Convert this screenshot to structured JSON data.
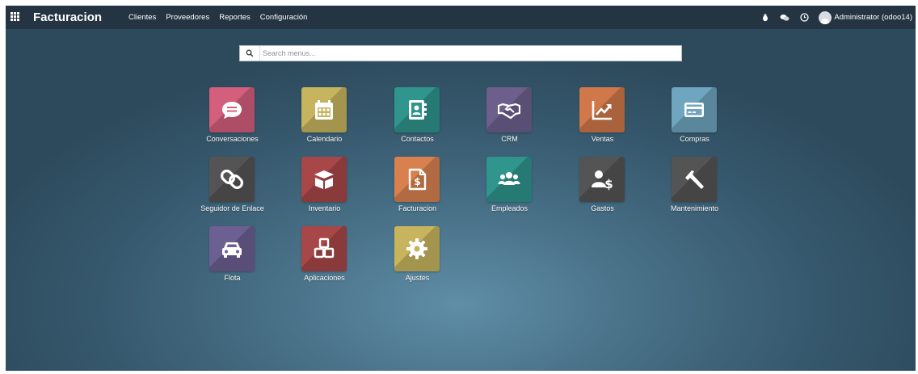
{
  "topbar": {
    "brand": "Facturacion",
    "menu": [
      "Clientes",
      "Proveedores",
      "Reportes",
      "Configuración"
    ],
    "user": "Administrator (odoo14)",
    "icons": [
      "apps-grid-icon",
      "bug-icon",
      "chat-icon",
      "clock-icon"
    ]
  },
  "search": {
    "placeholder": "Search menus..."
  },
  "apps": [
    {
      "label": "Conversaciones",
      "color": "#d35f7c",
      "icon": "chat-bubble-icon"
    },
    {
      "label": "Calendario",
      "color": "#c7b45f",
      "icon": "calendar-icon"
    },
    {
      "label": "Contactos",
      "color": "#2f958d",
      "icon": "address-book-icon"
    },
    {
      "label": "CRM",
      "color": "#6d5f8c",
      "icon": "handshake-icon"
    },
    {
      "label": "Ventas",
      "color": "#d0784a",
      "icon": "chart-line-icon"
    },
    {
      "label": "Compras",
      "color": "#6fa5be",
      "icon": "credit-card-icon"
    },
    {
      "label": "Seguidor de Enlace",
      "color": "#545454",
      "icon": "link-icon"
    },
    {
      "label": "Inventario",
      "color": "#a84747",
      "icon": "box-icon"
    },
    {
      "label": "Facturacion",
      "color": "#d8814f",
      "icon": "invoice-icon"
    },
    {
      "label": "Empleados",
      "color": "#2f958d",
      "icon": "users-icon"
    },
    {
      "label": "Gastos",
      "color": "#545454",
      "icon": "user-dollar-icon"
    },
    {
      "label": "Mantenimiento",
      "color": "#545454",
      "icon": "hammer-icon"
    },
    {
      "label": "Flota",
      "color": "#6c5f92",
      "icon": "car-icon"
    },
    {
      "label": "Aplicaciones",
      "color": "#a84747",
      "icon": "cubes-icon"
    },
    {
      "label": "Ajustes",
      "color": "#c7b45f",
      "icon": "gear-icon"
    }
  ]
}
